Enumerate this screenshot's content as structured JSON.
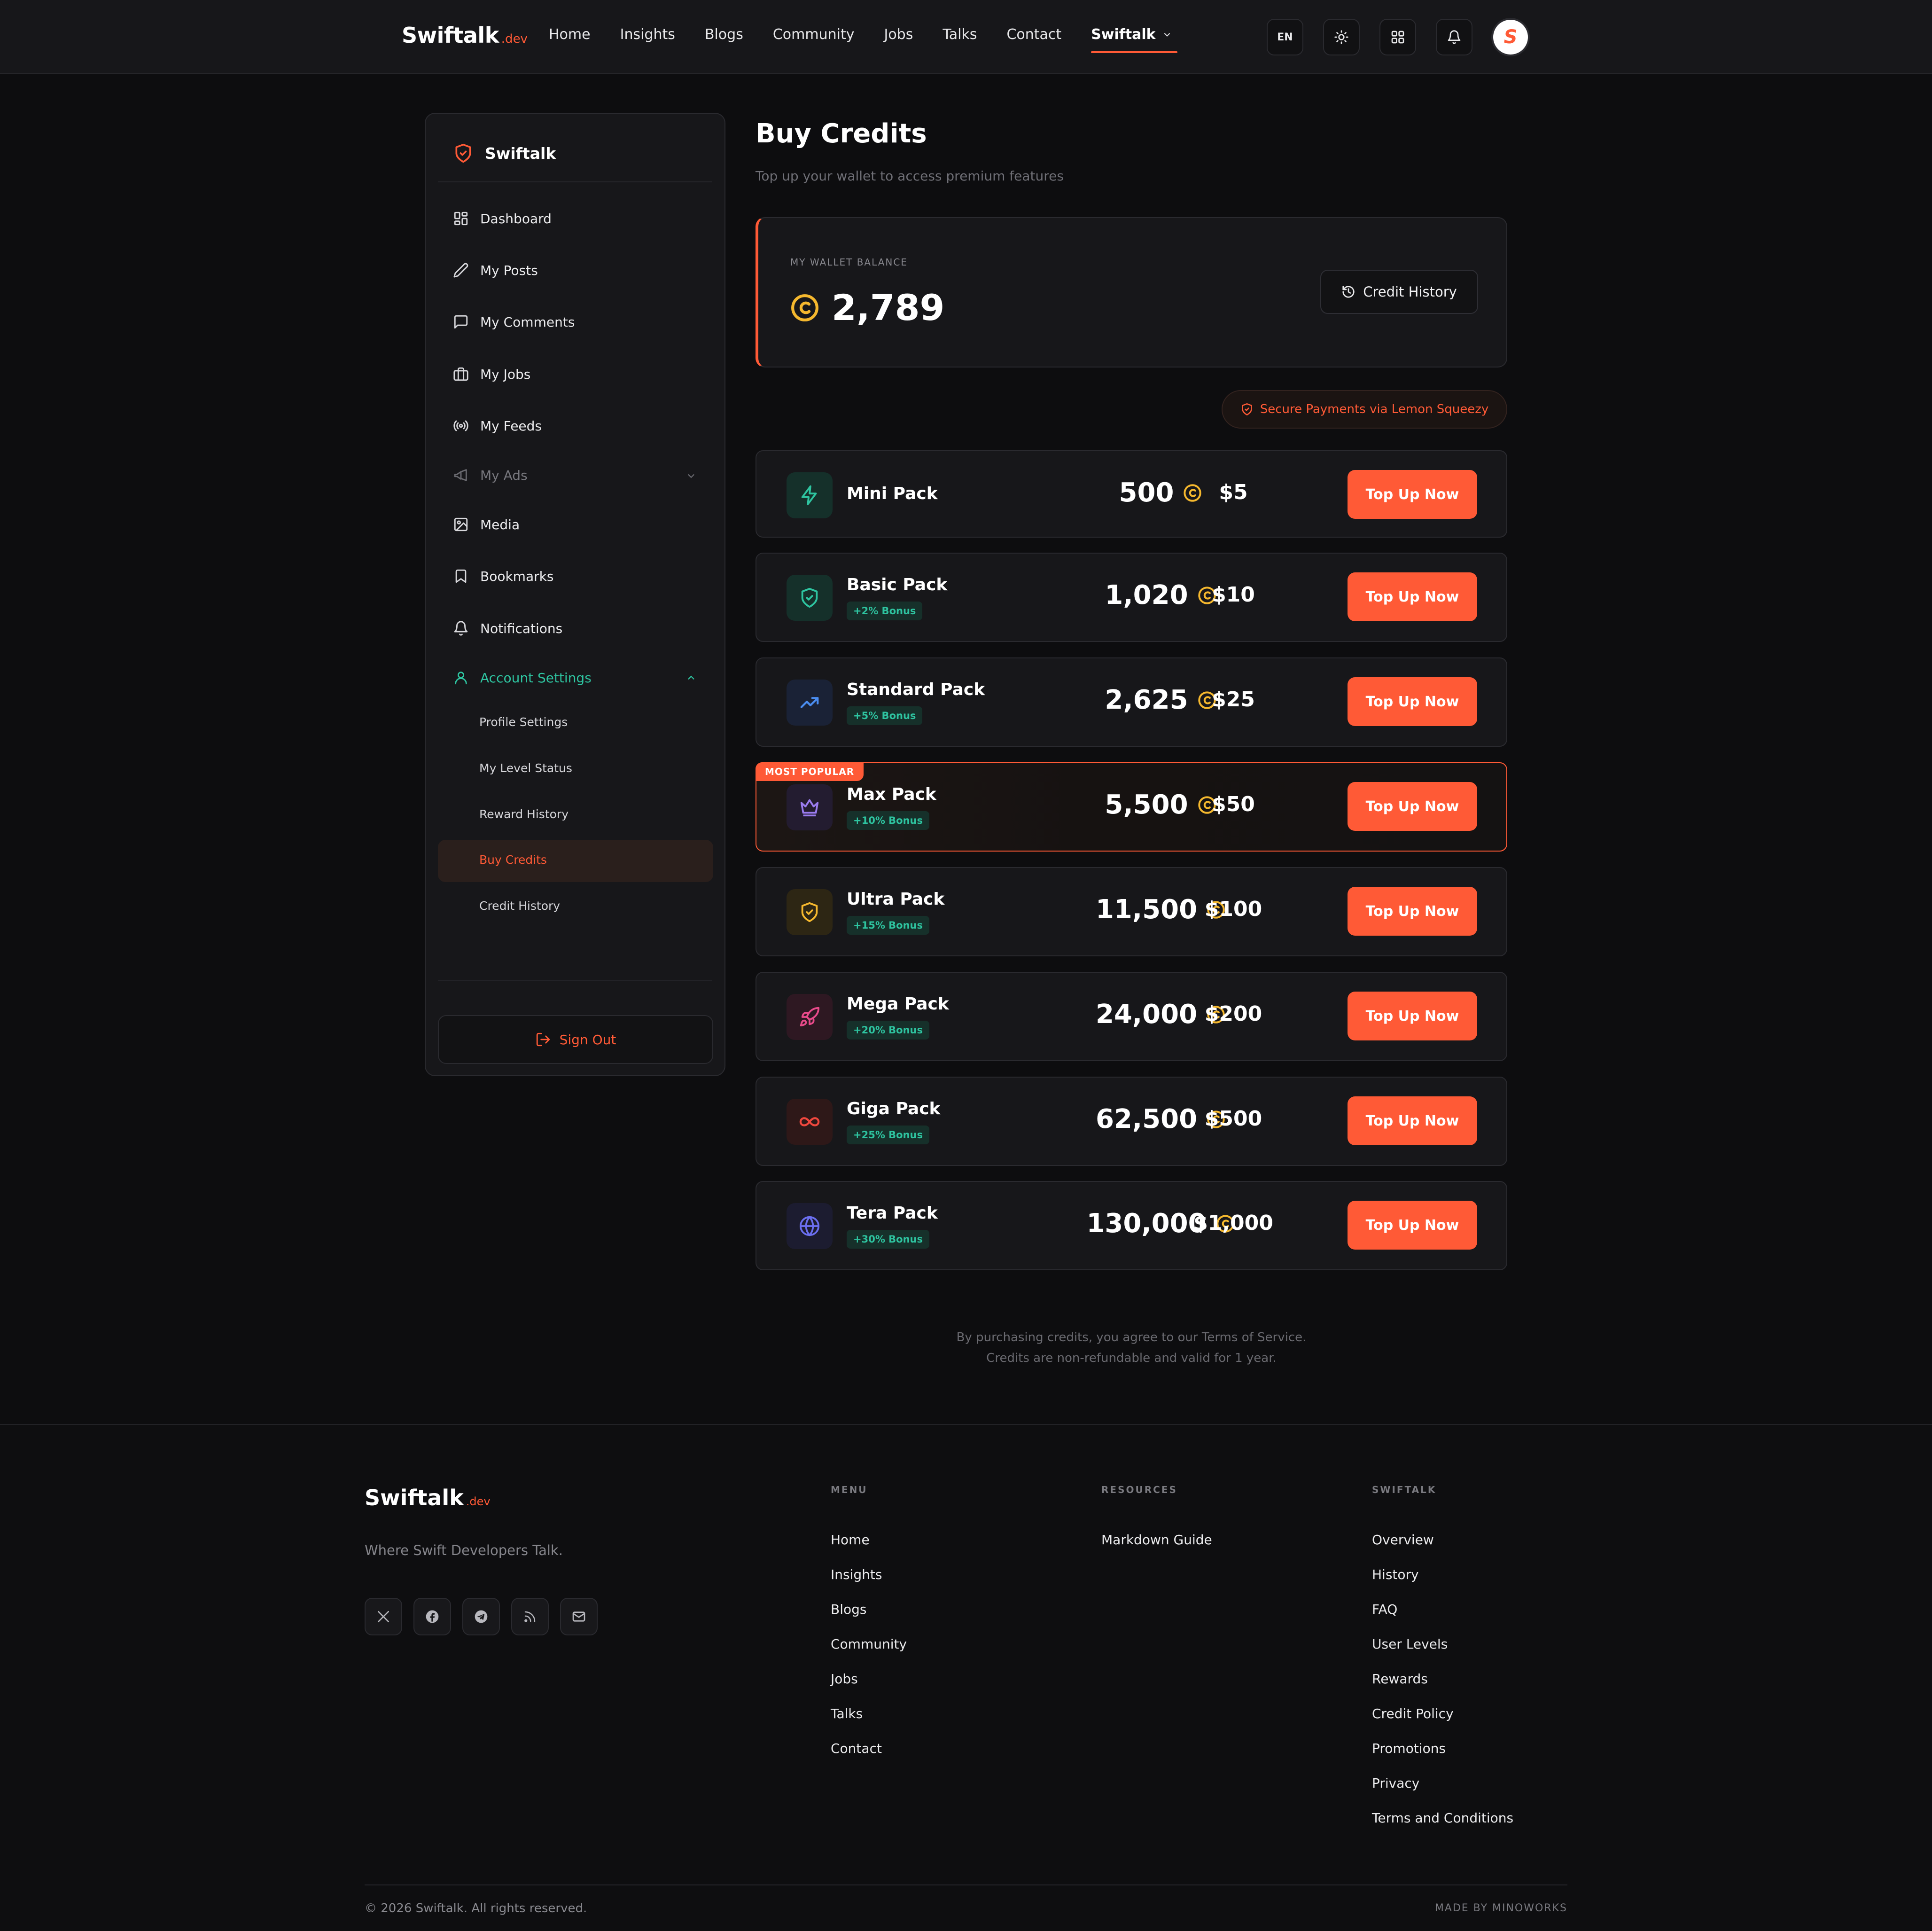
{
  "header": {
    "brand": "Swiftalk",
    "brand_tld": ".dev",
    "nav": [
      "Home",
      "Insights",
      "Blogs",
      "Community",
      "Jobs",
      "Talks",
      "Contact",
      "Swiftalk"
    ],
    "language": "EN",
    "avatar_letter": "S"
  },
  "sidebar": {
    "title": "Swiftalk",
    "items": {
      "dashboard": "Dashboard",
      "posts": "My Posts",
      "comments": "My Comments",
      "jobs": "My Jobs",
      "feeds": "My Feeds",
      "ads": "My Ads",
      "media": "Media",
      "bookmarks": "Bookmarks",
      "notifications": "Notifications",
      "account": "Account Settings"
    },
    "sub_items": {
      "profile": "Profile Settings",
      "level": "My Level Status",
      "reward": "Reward History",
      "buy": "Buy Credits",
      "credit_history": "Credit History"
    },
    "sign_out": "Sign Out"
  },
  "main": {
    "title": "Buy Credits",
    "subtitle": "Top up your wallet to access premium features",
    "wallet_label": "MY WALLET BALANCE",
    "wallet_balance": "2,789",
    "credit_history_button": "Credit History",
    "secure_badge": "Secure Payments via Lemon Squeezy",
    "popular_ribbon": "MOST POPULAR",
    "topup_label": "Top Up Now",
    "packs": [
      {
        "name": "Mini Pack",
        "bonus": "",
        "credits": "500",
        "price": "$5",
        "icon": "lightning-icon",
        "color": "#2ec4a0"
      },
      {
        "name": "Basic Pack",
        "bonus": "+2% Bonus",
        "credits": "1,020",
        "price": "$10",
        "icon": "shield-check-icon",
        "color": "#2ec4a0"
      },
      {
        "name": "Standard Pack",
        "bonus": "+5% Bonus",
        "credits": "2,625",
        "price": "$25",
        "icon": "trending-up-icon",
        "color": "#4a8df0"
      },
      {
        "name": "Max Pack",
        "bonus": "+10% Bonus",
        "credits": "5,500",
        "price": "$50",
        "icon": "crown-icon",
        "color": "#9b7cf0"
      },
      {
        "name": "Ultra Pack",
        "bonus": "+15% Bonus",
        "credits": "11,500",
        "price": "$100",
        "icon": "shield-check-icon",
        "color": "#f5b82e"
      },
      {
        "name": "Mega Pack",
        "bonus": "+20% Bonus",
        "credits": "24,000",
        "price": "$200",
        "icon": "rocket-icon",
        "color": "#e84a8a"
      },
      {
        "name": "Giga Pack",
        "bonus": "+25% Bonus",
        "credits": "62,500",
        "price": "$500",
        "icon": "infinity-icon",
        "color": "#f0483e"
      },
      {
        "name": "Tera Pack",
        "bonus": "+30% Bonus",
        "credits": "130,000",
        "price": "$1,000",
        "icon": "globe-icon",
        "color": "#6b6ff0"
      }
    ],
    "terms_line1": "By purchasing credits, you agree to our Terms of Service.",
    "terms_line2": "Credits are non-refundable and valid for 1 year."
  },
  "footer": {
    "brand": "Swiftalk",
    "brand_tld": ".dev",
    "tagline": "Where Swift Developers Talk.",
    "menu_heading": "MENU",
    "menu": [
      "Home",
      "Insights",
      "Blogs",
      "Community",
      "Jobs",
      "Talks",
      "Contact"
    ],
    "resources_heading": "RESOURCES",
    "resources": [
      "Markdown Guide"
    ],
    "swiftalk_heading": "SWIFTALK",
    "swiftalk": [
      "Overview",
      "History",
      "FAQ",
      "User Levels",
      "Rewards",
      "Credit Policy",
      "Promotions",
      "Privacy",
      "Terms and Conditions"
    ],
    "copyright": "© 2026 Swiftalk. All rights reserved.",
    "made_by": "MADE BY MINOWORKS"
  },
  "colors": {
    "accent": "#ff5a36",
    "teal": "#2ec4a0",
    "coin": "#f5b82e",
    "background": "#0d0d0f",
    "card": "#17171a"
  }
}
